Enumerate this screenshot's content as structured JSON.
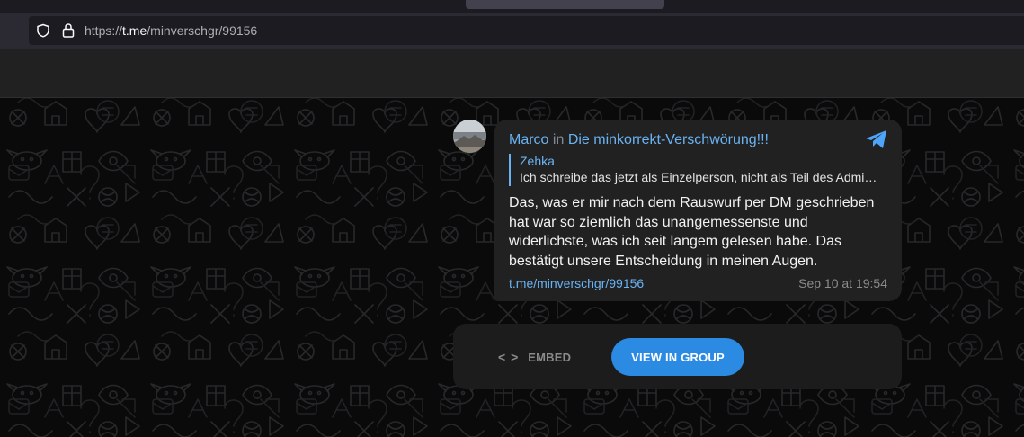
{
  "browser": {
    "url_scheme": "https://",
    "url_host": "t.me",
    "url_path": "/minverschgr/99156"
  },
  "post": {
    "author": "Marco",
    "in_word": "in",
    "group": "Die minkorrekt-Verschwörung!!!",
    "reply": {
      "name": "Zehka",
      "text": "Ich schreibe das jetzt als Einzelperson, nicht als Teil des Admin-…"
    },
    "text": "Das, was er mir nach dem Rauswurf per DM geschrieben hat war so ziemlich das unangemessenste und widerlichste, was ich seit langem gelesen habe. Das bestätigt unsere Entscheidung in meinen Augen.",
    "link": "t.me/minverschgr/99156",
    "time": "Sep 10 at 19:54"
  },
  "actions": {
    "embed_icon": "< >",
    "embed_label": "EMBED",
    "view_label": "VIEW IN GROUP"
  },
  "colors": {
    "accent": "#6ab3f3",
    "button": "#2b8ae2",
    "bubble": "#212121",
    "background": "#0a0a0a"
  },
  "icons": [
    "shield-icon",
    "lock-icon",
    "telegram-icon",
    "code-icon"
  ]
}
